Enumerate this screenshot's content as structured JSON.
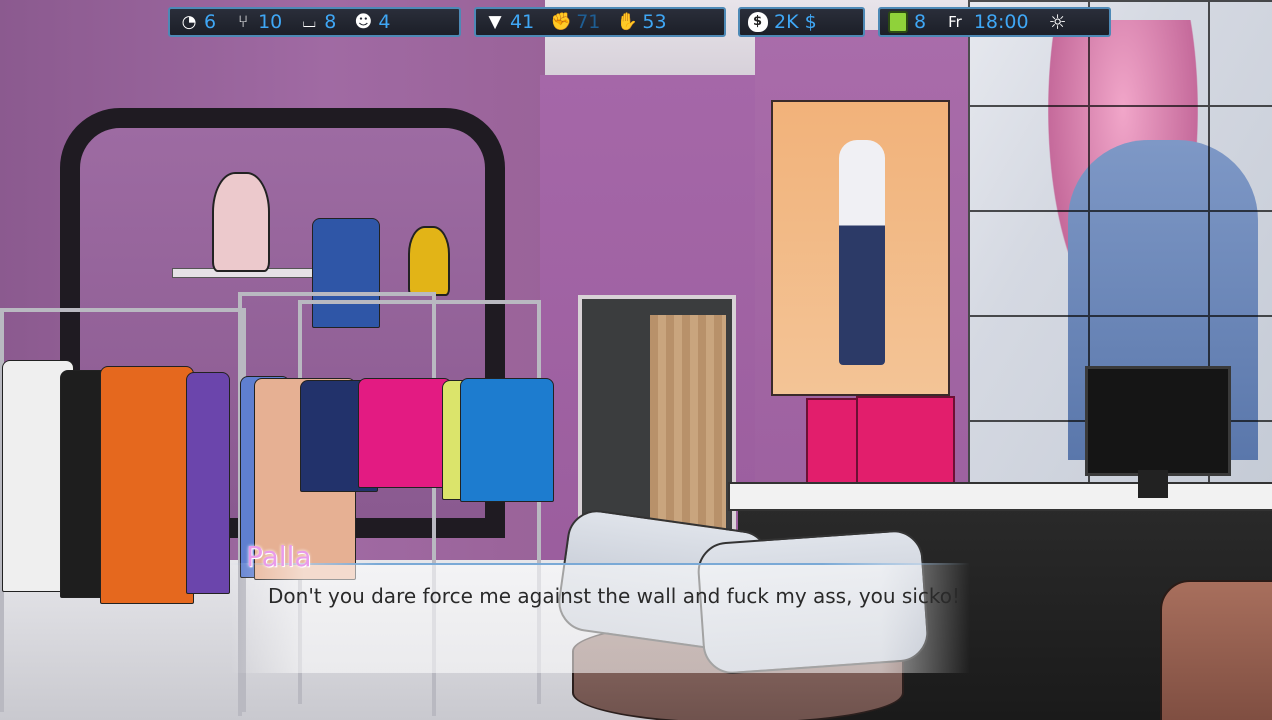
{
  "hud": {
    "needs": [
      {
        "icon": "energy-gauge-icon",
        "value": "6"
      },
      {
        "icon": "food-icon",
        "value": "10"
      },
      {
        "icon": "hygiene-bathtub-icon",
        "value": "8"
      },
      {
        "icon": "mask-mood-icon",
        "value": "4"
      }
    ],
    "skills": [
      {
        "icon": "education-cap-icon",
        "value": "41"
      },
      {
        "icon": "fitness-arm-icon",
        "value": "71"
      },
      {
        "icon": "charisma-handshake-icon",
        "value": "53"
      }
    ],
    "money": {
      "icon": "money-bag-icon",
      "value": "2K $"
    },
    "time": {
      "phone_icon": "phone-icon",
      "phone_value": "8",
      "day": "Fr",
      "clock": "18:00",
      "weather_icon": "sun-icon"
    }
  },
  "dialogue": {
    "speaker": "Palla",
    "text": "Don't you dare force me against the wall and fuck my ass, you sicko!"
  },
  "colors": {
    "accent": "#3fa7f5",
    "border": "#4d89b6",
    "speaker": "#e99bea"
  }
}
